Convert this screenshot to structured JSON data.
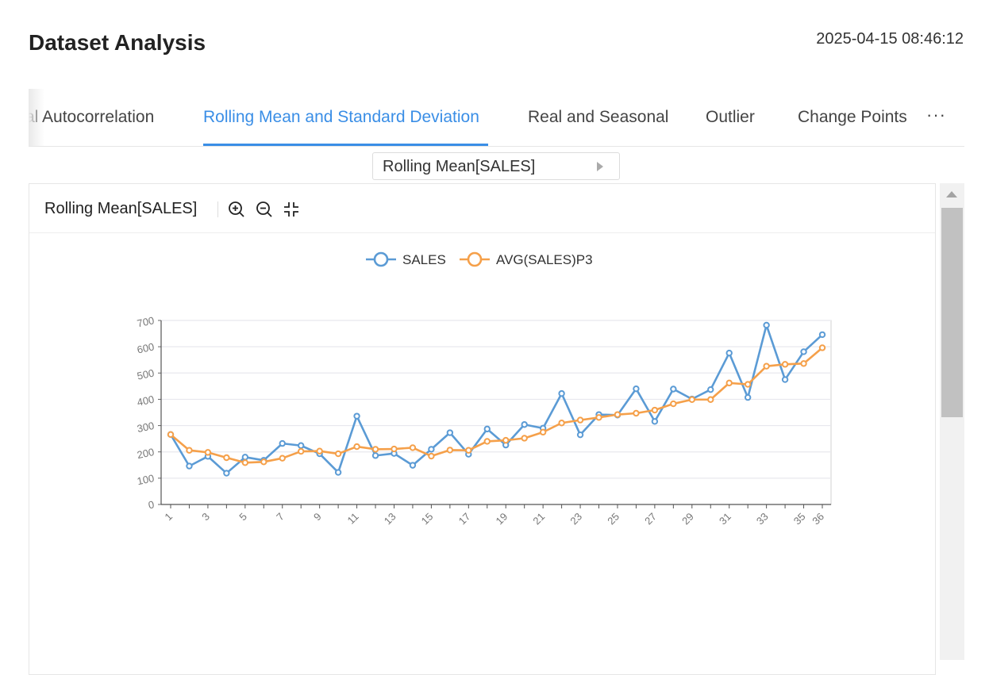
{
  "header": {
    "title": "Dataset Analysis",
    "timestamp": "2025-04-15 08:46:12"
  },
  "tabs": [
    {
      "label": "al Autocorrelation"
    },
    {
      "label": "Rolling Mean and Standard Deviation",
      "active": true
    },
    {
      "label": "Real and Seasonal"
    },
    {
      "label": "Outlier"
    },
    {
      "label": "Change Points"
    }
  ],
  "tabs_more": "···",
  "selector": {
    "value": "Rolling Mean[SALES]"
  },
  "panel": {
    "title": "Rolling Mean[SALES]",
    "icons": [
      "zoom-in-icon",
      "zoom-out-icon",
      "collapse-icon"
    ]
  },
  "colors": {
    "accent": "#3a8ee6",
    "sales": "#5b9bd5",
    "avg": "#f5a04a"
  },
  "chart_data": {
    "type": "line",
    "legend_position": "top-center",
    "x": [
      1,
      2,
      3,
      4,
      5,
      6,
      7,
      8,
      9,
      10,
      11,
      12,
      13,
      14,
      15,
      16,
      17,
      18,
      19,
      20,
      21,
      22,
      23,
      24,
      25,
      26,
      27,
      28,
      29,
      30,
      31,
      32,
      33,
      34,
      35,
      36
    ],
    "x_tick_labels": [
      "1",
      "3",
      "5",
      "7",
      "9",
      "11",
      "13",
      "15",
      "17",
      "19",
      "21",
      "23",
      "25",
      "27",
      "29",
      "31",
      "33",
      "35",
      "36"
    ],
    "y_ticks": [
      "0",
      "100",
      "200",
      "300",
      "400",
      "500",
      "600",
      "700"
    ],
    "ylim": [
      0,
      700
    ],
    "grid": true,
    "series": [
      {
        "name": "SALES",
        "color": "#5b9bd5",
        "values": [
          266,
          146,
          183,
          119,
          180,
          168,
          232,
          224,
          193,
          122,
          336,
          186,
          194,
          149,
          210,
          273,
          191,
          287,
          226,
          304,
          290,
          422,
          265,
          342,
          340,
          440,
          316,
          439,
          401,
          437,
          576,
          407,
          682,
          475,
          581,
          646
        ]
      },
      {
        "name": "AVG(SALES)P3",
        "color": "#f5a04a",
        "values": [
          266,
          206,
          198,
          178,
          159,
          162,
          176,
          202,
          203,
          193,
          220,
          210,
          211,
          216,
          184,
          207,
          206,
          240,
          244,
          252,
          275,
          310,
          321,
          331,
          342,
          347,
          359,
          383,
          399,
          399,
          462,
          457,
          526,
          533,
          536,
          596
        ]
      }
    ]
  }
}
